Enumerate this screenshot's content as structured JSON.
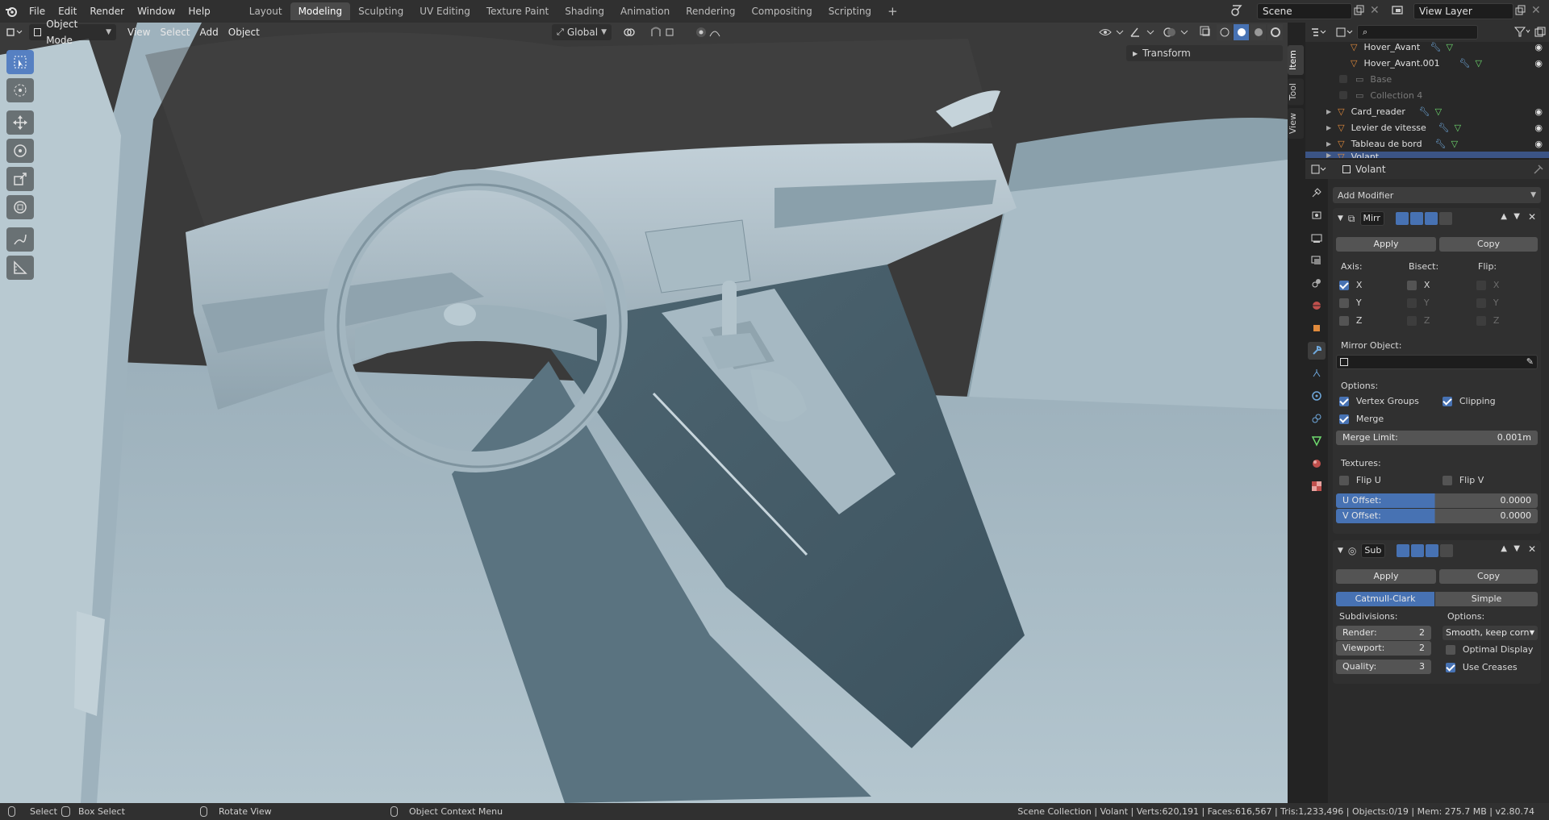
{
  "topbar": {
    "menus": [
      "File",
      "Edit",
      "Render",
      "Window",
      "Help"
    ],
    "workspaces": [
      "Layout",
      "Modeling",
      "Sculpting",
      "UV Editing",
      "Texture Paint",
      "Shading",
      "Animation",
      "Rendering",
      "Compositing",
      "Scripting"
    ],
    "active_workspace": "Modeling",
    "add_tab": "+",
    "scene": "Scene",
    "view_layer": "View Layer"
  },
  "viewport_header": {
    "mode": "Object Mode",
    "menus": [
      "View",
      "Select",
      "Add",
      "Object"
    ],
    "orientation": "Global"
  },
  "sidebar": {
    "tabs": [
      "Item",
      "Tool",
      "View"
    ],
    "transform_label": "Transform"
  },
  "outliner": {
    "items": [
      {
        "name": "Hover_Avant",
        "dim": false
      },
      {
        "name": "Hover_Avant.001",
        "dim": false
      },
      {
        "name": "Base",
        "dim": true
      },
      {
        "name": "Collection 4",
        "dim": true
      },
      {
        "name": "Card_reader",
        "dim": false
      },
      {
        "name": "Levier de vitesse",
        "dim": false
      },
      {
        "name": "Tableau de bord",
        "dim": false
      },
      {
        "name": "Volant",
        "dim": false
      }
    ]
  },
  "properties": {
    "object_name": "Volant",
    "add_modifier": "Add Modifier",
    "mirror": {
      "name": "Mirr",
      "apply": "Apply",
      "copy": "Copy",
      "axis_label": "Axis:",
      "bisect_label": "Bisect:",
      "flip_label": "Flip:",
      "axis": [
        {
          "l": "X",
          "on": true
        },
        {
          "l": "Y",
          "on": false
        },
        {
          "l": "Z",
          "on": false
        }
      ],
      "bisect": [
        "X",
        "Y",
        "Z"
      ],
      "flip": [
        "X",
        "Y",
        "Z"
      ],
      "mirror_object_label": "Mirror Object:",
      "options_label": "Options:",
      "vertex_groups": "Vertex Groups",
      "clipping": "Clipping",
      "merge": "Merge",
      "merge_limit_label": "Merge Limit:",
      "merge_limit": "0.001m",
      "textures_label": "Textures:",
      "flip_u": "Flip U",
      "flip_v": "Flip V",
      "u_offset_label": "U Offset:",
      "u_offset": "0.0000",
      "v_offset_label": "V Offset:",
      "v_offset": "0.0000"
    },
    "subsurf": {
      "name": "Sub",
      "apply": "Apply",
      "copy": "Copy",
      "catmull": "Catmull-Clark",
      "simple": "Simple",
      "subdivisions_label": "Subdivisions:",
      "options_label": "Options:",
      "render_label": "Render:",
      "render": "2",
      "viewport_label": "Viewport:",
      "viewport": "2",
      "quality_label": "Quality:",
      "quality": "3",
      "uv_smooth": "Smooth, keep corn...",
      "optimal_display": "Optimal Display",
      "use_creases": "Use Creases"
    }
  },
  "statusbar": {
    "select": "Select",
    "box_select": "Box Select",
    "rotate_view": "Rotate View",
    "context_menu": "Object Context Menu",
    "stats": "Scene Collection | Volant | Verts:620,191 | Faces:616,567 | Tris:1,233,496 | Objects:0/19 | Mem: 275.7 MB | v2.80.74"
  },
  "colors": {
    "accent": "#4772b3",
    "selected_row": "#3b5485",
    "object_orange": "#e08a3c",
    "modifier_blue": "#6fa8dc",
    "mesh_green": "#6fdb6f"
  }
}
